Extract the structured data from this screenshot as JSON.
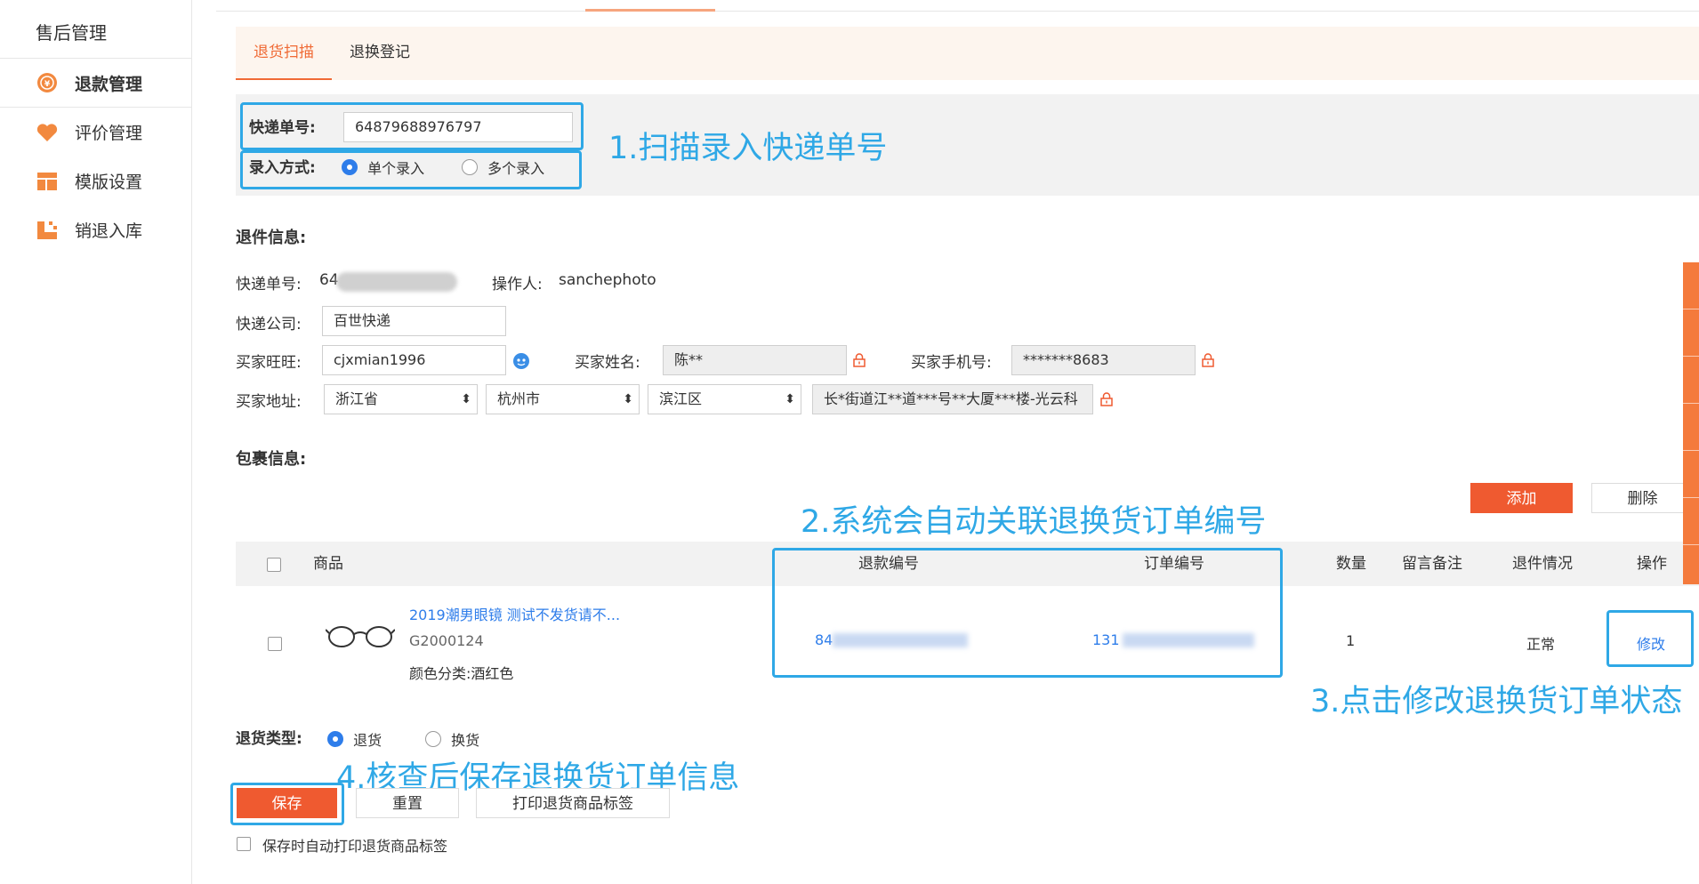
{
  "sidebar": {
    "title": "售后管理",
    "items": [
      {
        "label": "退款管理",
        "icon": "refund-icon"
      },
      {
        "label": "评价管理",
        "icon": "heart-icon"
      },
      {
        "label": "模版设置",
        "icon": "template-icon"
      },
      {
        "label": "销退入库",
        "icon": "warehouse-icon"
      }
    ]
  },
  "tabs": [
    "退货扫描",
    "退换登记"
  ],
  "scan": {
    "tracking_label": "快递单号:",
    "tracking_value": "64879688976797",
    "mode_label": "录入方式:",
    "mode_single": "单个录入",
    "mode_multi": "多个录入"
  },
  "annotations": {
    "a1": "1.扫描录入快递单号",
    "a2": "2.系统会自动关联退换货订单编号",
    "a3": "3.点击修改退换货订单状态",
    "a4": "4.核查后保存退换货订单信息"
  },
  "return_info": {
    "section_title": "退件信息:",
    "tracking_label": "快递单号:",
    "tracking_value": "64",
    "operator_label": "操作人:",
    "operator_value": "sanchephoto",
    "courier_label": "快递公司:",
    "courier_value": "百世快递",
    "wangwang_label": "买家旺旺:",
    "wangwang_value": "cjxmian1996",
    "name_label": "买家姓名:",
    "name_value": "陈**",
    "phone_label": "买家手机号:",
    "phone_value": "*******8683",
    "address_label": "买家地址:",
    "province": "浙江省",
    "city": "杭州市",
    "district": "滨江区",
    "street": "长*街道江**道***号**大厦***楼-光云科"
  },
  "package": {
    "section_title": "包裹信息:",
    "add_label": "添加",
    "delete_label": "删除",
    "headers": {
      "product": "商品",
      "refund_no": "退款编号",
      "order_no": "订单编号",
      "qty": "数量",
      "remark": "留言备注",
      "status": "退件情况",
      "action": "操作"
    },
    "row": {
      "title": "2019潮男眼镜 测试不发货请不...",
      "sku": "G2000124",
      "attr": "颜色分类:酒红色",
      "refund_no": "84",
      "order_no": "131",
      "qty": "1",
      "status": "正常",
      "action": "修改"
    }
  },
  "footer": {
    "type_label": "退货类型:",
    "type_return": "退货",
    "type_exchange": "换货",
    "save": "保存",
    "reset": "重置",
    "print": "打印退货商品标签",
    "auto_print": "保存时自动打印退货商品标签"
  },
  "colors": {
    "accent": "#ef5a30",
    "annotation": "#2fa8e6",
    "link": "#2e7dea"
  }
}
